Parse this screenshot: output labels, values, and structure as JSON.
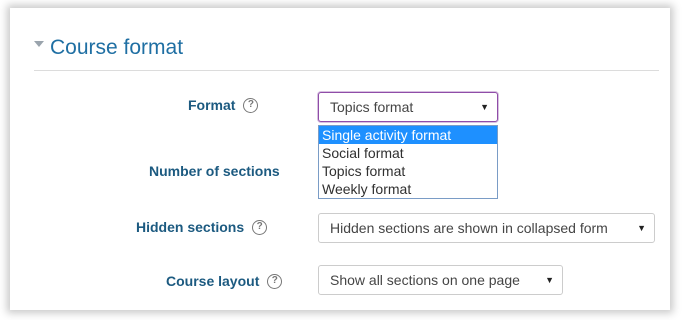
{
  "section": {
    "title": "Course format"
  },
  "format": {
    "label": "Format",
    "selected": "Topics format",
    "options": [
      "Single activity format",
      "Social format",
      "Topics format",
      "Weekly format"
    ],
    "highlighted_option": "Single activity format",
    "help": "?"
  },
  "num_sections": {
    "label": "Number of sections"
  },
  "hidden_sections": {
    "label": "Hidden sections",
    "selected": "Hidden sections are shown in collapsed form",
    "help": "?"
  },
  "course_layout": {
    "label": "Course layout",
    "selected": "Show all sections on one page",
    "help": "?"
  },
  "icons": {
    "collapse": "caret-down-icon",
    "help": "question-circle-icon",
    "dropdown": "select-arrow-icon"
  },
  "colors": {
    "header_text": "#1f6fa3",
    "label_text": "#1c5a80",
    "focus_border": "#8f4da8",
    "highlight": "#1e90ff"
  }
}
